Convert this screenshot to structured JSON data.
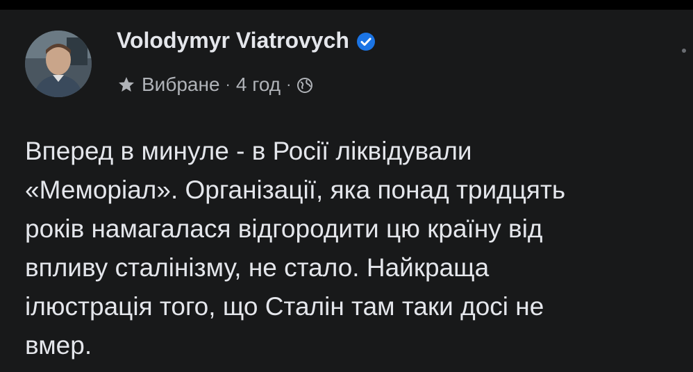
{
  "post": {
    "author": "Volodymyr Viatrovych",
    "verified_icon": "verified-badge-icon",
    "meta": {
      "audience": "Вибране",
      "separator": "·",
      "time": "4 год",
      "privacy_icon": "globe-icon",
      "audience_icon": "star-icon"
    },
    "text_lines": [
      "Вперед в минуле - в Росії ліквідували",
      "«Меморіал». Організації, яка понад тридцять",
      "років намагалася відгородити цю країну від",
      "впливу сталінізму, не стало. Найкраща",
      "ілюстрація того, що Сталін там таки досі не",
      "вмер."
    ]
  },
  "colors": {
    "background": "#18191a",
    "text_primary": "#e4e6eb",
    "text_secondary": "#b0b3b8",
    "verified_blue": "#1b74e4"
  }
}
